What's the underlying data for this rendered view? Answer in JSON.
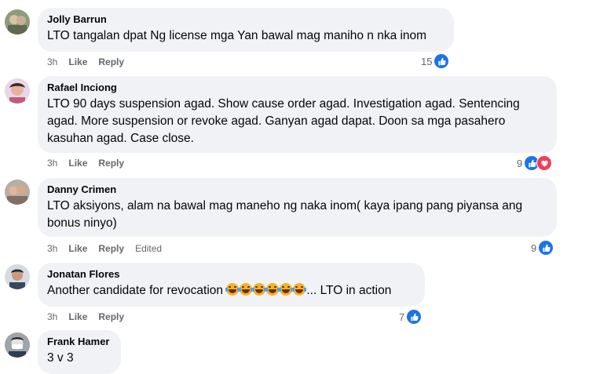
{
  "comments": [
    {
      "author": "Jolly Barrun",
      "lines": [
        "LTO tangalan dpat Ng license mga Yan bawal mag maniho n nka inom"
      ],
      "time": "3h",
      "like": "Like",
      "reply": "Reply",
      "edited": "",
      "reaction_count": "15",
      "reactions": [
        "like"
      ]
    },
    {
      "author": "Rafael Inciong",
      "lines": [
        "LTO 90 days suspension agad. Show cause order agad. Investigation agad. Sentencing",
        "agad. More suspension or revoke agad. Ganyan agad dapat. Doon sa mga pasahero",
        "kasuhan agad. Case close."
      ],
      "time": "3h",
      "like": "Like",
      "reply": "Reply",
      "edited": "",
      "reaction_count": "9",
      "reactions": [
        "like",
        "love"
      ]
    },
    {
      "author": "Danny Crimen",
      "lines": [
        "LTO aksiyons, alam na bawal mag maneho ng naka inom( kaya ipang pang piyansa ang",
        "bonus ninyo)"
      ],
      "time": "3h",
      "like": "Like",
      "reply": "Reply",
      "edited": "Edited",
      "reaction_count": "9",
      "reactions": [
        "like"
      ]
    },
    {
      "author": "Jonatan Flores",
      "text_before": "Another candidate for revocation ",
      "emoji_count": 6,
      "text_after": "... LTO in action",
      "time": "3h",
      "like": "Like",
      "reply": "Reply",
      "edited": "",
      "reaction_count": "7",
      "reactions": [
        "like"
      ]
    },
    {
      "author": "Frank Hamer",
      "lines": [
        "3 v 3"
      ]
    }
  ],
  "colors": {
    "bubble": "#f0f2f5",
    "secondary_text": "#65676b",
    "like_blue": "#1b74e4",
    "love_red": "#f33e58"
  },
  "icons": {
    "like": "thumbs-up-icon",
    "love": "heart-icon",
    "emoji": "face-with-tears-of-joy-icon"
  }
}
